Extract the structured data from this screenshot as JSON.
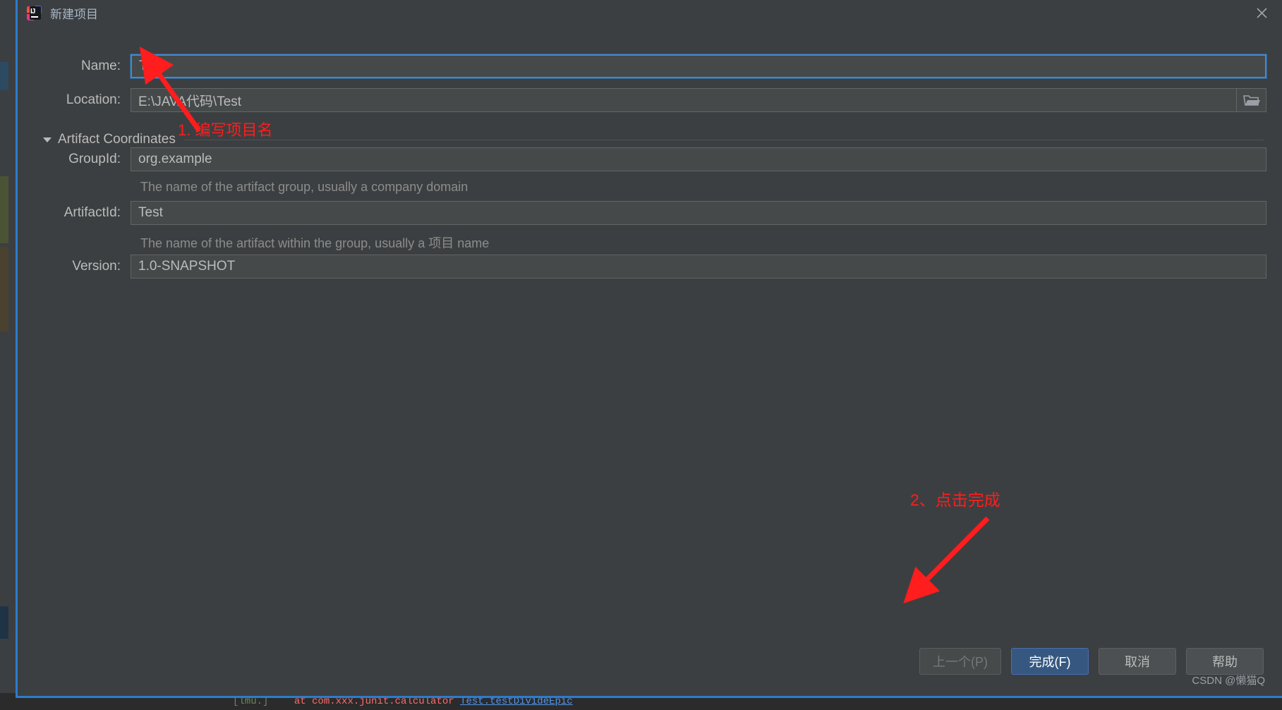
{
  "window": {
    "title": "新建项目",
    "app_icon": "intellij-idea-icon",
    "close_icon": "close-icon"
  },
  "form": {
    "name": {
      "label": "Name:",
      "value": "Test",
      "focused": true
    },
    "location": {
      "label": "Location:",
      "value": "E:\\JAVA代码\\Test",
      "browse_icon": "folder-icon"
    },
    "section": {
      "title": "Artifact Coordinates",
      "expanded": true,
      "toggle_icon": "triangle-down-icon"
    },
    "group_id": {
      "label": "GroupId:",
      "value": "org.example",
      "hint": "The name of the artifact group, usually a company domain"
    },
    "artifact_id": {
      "label": "ArtifactId:",
      "value": "Test",
      "hint": "The name of the artifact within the group, usually a 项目 name"
    },
    "version": {
      "label": "Version:",
      "value": "1.0-SNAPSHOT"
    }
  },
  "buttons": {
    "previous": "上一个(P)",
    "finish": "完成(F)",
    "cancel": "取消",
    "help": "帮助"
  },
  "annotations": {
    "step1": "1. 编写项目名",
    "step2": "2、点击完成"
  },
  "watermark": "CSDN @懒猫Q",
  "background": {
    "console_lmu": "[lmu.]",
    "console_error": "at com.xxx.junit.calculator",
    "console_link": "Test.testDivideEpic"
  },
  "colors": {
    "dialog_bg": "#3c3f41",
    "field_bg": "#45494a",
    "text": "#bbbbbb",
    "hint_text": "#8c8c8c",
    "accent_blue": "#2d7ccc",
    "focus_border": "#4a88c7",
    "primary_button": "#365880",
    "annotation_red": "#ff1d1d"
  }
}
